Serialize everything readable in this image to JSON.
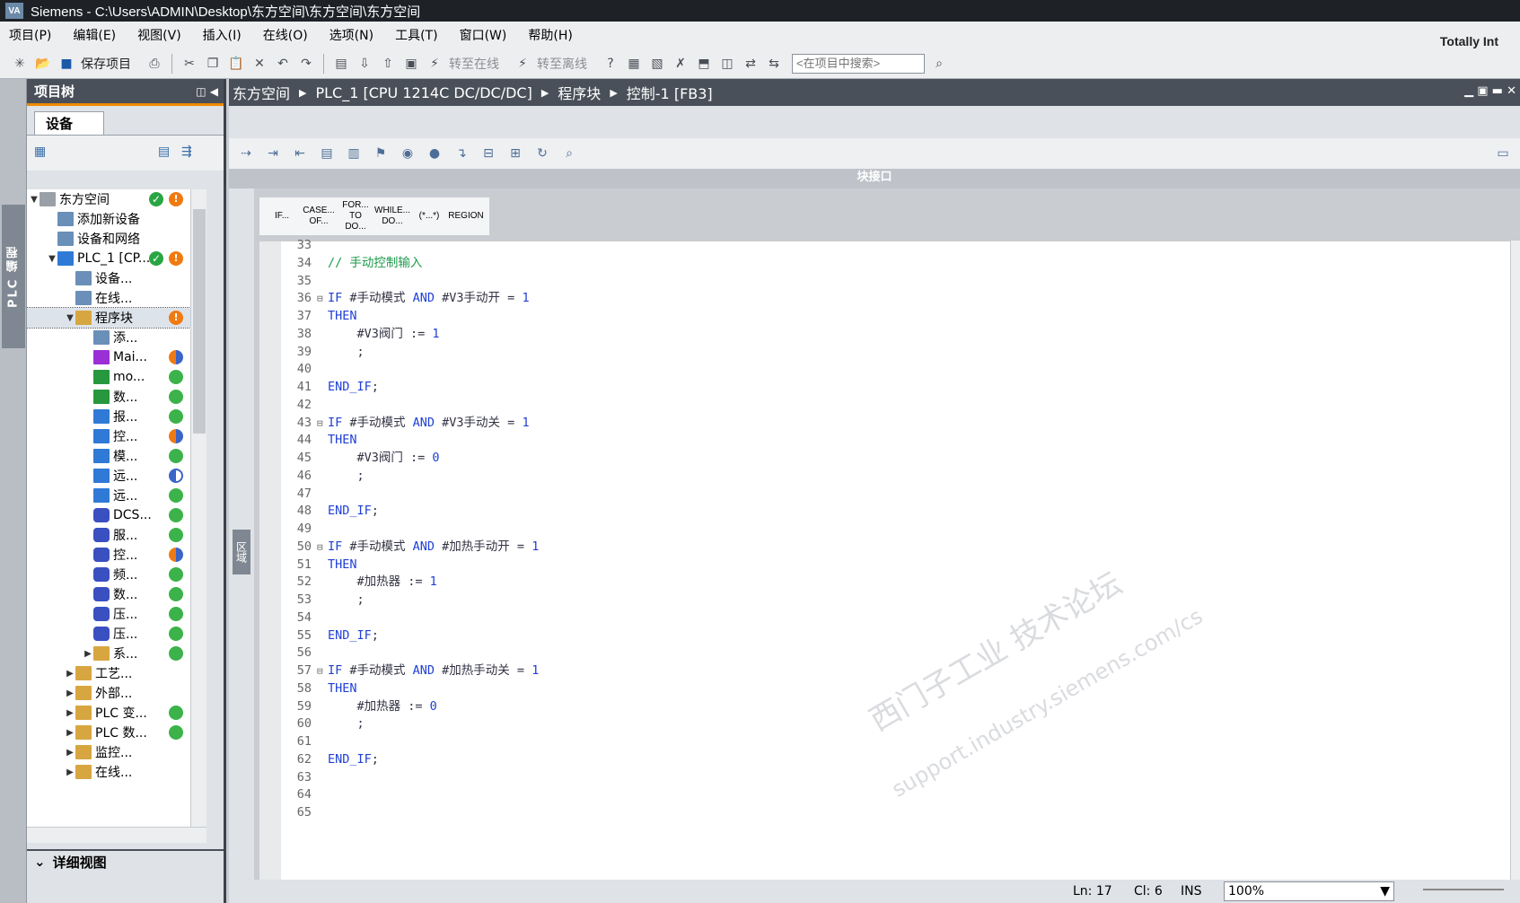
{
  "titlebar": {
    "logo": "VA",
    "text": "Siemens  -  C:\\Users\\ADMIN\\Desktop\\东方空间\\东方空间\\东方空间"
  },
  "menu": [
    "项目(P)",
    "编辑(E)",
    "视图(V)",
    "插入(I)",
    "在线(O)",
    "选项(N)",
    "工具(T)",
    "窗口(W)",
    "帮助(H)"
  ],
  "brand": "Totally Int",
  "toolbar": {
    "save_label": "保存项目",
    "go_online": "转至在线",
    "go_offline": "转至离线",
    "search_placeholder": "<在项目中搜索>"
  },
  "left_tab": "PLC 编程",
  "tree": {
    "title": "项目树",
    "device_tab": "设备",
    "items": [
      {
        "label": "东方空间",
        "indent": 0,
        "arrow": "▼",
        "icon": "project-icon",
        "status": "check",
        "status2": "warn"
      },
      {
        "label": "添加新设备",
        "indent": 1,
        "arrow": "",
        "icon": "add-device-icon"
      },
      {
        "label": "设备和网络",
        "indent": 1,
        "arrow": "",
        "icon": "network-icon"
      },
      {
        "label": "PLC_1 [CP...",
        "indent": 1,
        "arrow": "▼",
        "icon": "plc-icon",
        "status": "check",
        "status2": "warn"
      },
      {
        "label": "设备...",
        "indent": 2,
        "arrow": "",
        "icon": "device-config-icon"
      },
      {
        "label": "在线...",
        "indent": 2,
        "arrow": "",
        "icon": "online-diag-icon"
      },
      {
        "label": "程序块",
        "indent": 2,
        "arrow": "▼",
        "icon": "folder-icon",
        "status2": "warn",
        "selected": true
      },
      {
        "label": "添...",
        "indent": 3,
        "arrow": "",
        "icon": "add-block-icon"
      },
      {
        "label": "Mai...",
        "indent": 3,
        "arrow": "",
        "icon": "ob-icon",
        "status2": "half"
      },
      {
        "label": "mo...",
        "indent": 3,
        "arrow": "",
        "icon": "fc-icon",
        "status2": "green"
      },
      {
        "label": "数...",
        "indent": 3,
        "arrow": "",
        "icon": "fc-icon",
        "status2": "green"
      },
      {
        "label": "报...",
        "indent": 3,
        "arrow": "",
        "icon": "fb-icon",
        "status2": "green"
      },
      {
        "label": "控...",
        "indent": 3,
        "arrow": "",
        "icon": "fb-icon",
        "status2": "half"
      },
      {
        "label": "模...",
        "indent": 3,
        "arrow": "",
        "icon": "fb-icon",
        "status2": "green"
      },
      {
        "label": "远...",
        "indent": 3,
        "arrow": "",
        "icon": "fb-icon",
        "status2": "halfw"
      },
      {
        "label": "远...",
        "indent": 3,
        "arrow": "",
        "icon": "fb-icon",
        "status2": "green"
      },
      {
        "label": "DCS...",
        "indent": 3,
        "arrow": "",
        "icon": "db-icon",
        "status2": "green"
      },
      {
        "label": "服...",
        "indent": 3,
        "arrow": "",
        "icon": "db-icon",
        "status2": "green"
      },
      {
        "label": "控...",
        "indent": 3,
        "arrow": "",
        "icon": "db-icon",
        "status2": "half"
      },
      {
        "label": "频...",
        "indent": 3,
        "arrow": "",
        "icon": "db-icon",
        "status2": "green"
      },
      {
        "label": "数...",
        "indent": 3,
        "arrow": "",
        "icon": "db-icon",
        "status2": "green"
      },
      {
        "label": "压...",
        "indent": 3,
        "arrow": "",
        "icon": "db-icon",
        "status2": "green"
      },
      {
        "label": "压...",
        "indent": 3,
        "arrow": "",
        "icon": "db-icon",
        "status2": "green"
      },
      {
        "label": "系...",
        "indent": 3,
        "arrow": "▶",
        "icon": "folder-icon",
        "status2": "green"
      },
      {
        "label": "工艺...",
        "indent": 2,
        "arrow": "▶",
        "icon": "folder-icon"
      },
      {
        "label": "外部...",
        "indent": 2,
        "arrow": "▶",
        "icon": "folder-icon"
      },
      {
        "label": "PLC 变...",
        "indent": 2,
        "arrow": "▶",
        "icon": "folder-icon",
        "status2": "green"
      },
      {
        "label": "PLC 数...",
        "indent": 2,
        "arrow": "▶",
        "icon": "folder-icon",
        "status2": "green"
      },
      {
        "label": "监控...",
        "indent": 2,
        "arrow": "▶",
        "icon": "folder-icon"
      },
      {
        "label": "在线...",
        "indent": 2,
        "arrow": "▶",
        "icon": "folder-icon"
      }
    ],
    "detail_view": "详细视图"
  },
  "editor": {
    "breadcrumb": [
      "东方空间",
      "PLC_1 [CPU 1214C DC/DC/DC]",
      "程序块",
      "控制-1 [FB3]"
    ],
    "interface_bar": "块接口",
    "side_label": "区域",
    "snippets": [
      "IF...",
      "CASE... OF...",
      "FOR... TO DO...",
      "WHILE... DO...",
      "(*...*)",
      "REGION"
    ],
    "code": [
      {
        "n": "33",
        "t": ""
      },
      {
        "n": "34",
        "t": "// 手动控制输入",
        "cls": "cm"
      },
      {
        "n": "35",
        "t": ""
      },
      {
        "n": "36",
        "fold": true,
        "t": "IF #手动模式 AND #V3手动开 = 1"
      },
      {
        "n": "37",
        "t": "THEN",
        "cls": "kw"
      },
      {
        "n": "38",
        "t": "    #V3阀门 := 1"
      },
      {
        "n": "39",
        "t": "    ;"
      },
      {
        "n": "40",
        "t": ""
      },
      {
        "n": "41",
        "t": "END_IF;"
      },
      {
        "n": "42",
        "t": ""
      },
      {
        "n": "43",
        "fold": true,
        "t": "IF #手动模式 AND #V3手动关 = 1"
      },
      {
        "n": "44",
        "t": "THEN",
        "cls": "kw"
      },
      {
        "n": "45",
        "t": "    #V3阀门 := 0"
      },
      {
        "n": "46",
        "t": "    ;"
      },
      {
        "n": "47",
        "t": ""
      },
      {
        "n": "48",
        "t": "END_IF;"
      },
      {
        "n": "49",
        "t": ""
      },
      {
        "n": "50",
        "fold": true,
        "t": "IF #手动模式 AND #加热手动开 = 1"
      },
      {
        "n": "51",
        "t": "THEN",
        "cls": "kw"
      },
      {
        "n": "52",
        "t": "    #加热器 := 1"
      },
      {
        "n": "53",
        "t": "    ;"
      },
      {
        "n": "54",
        "t": ""
      },
      {
        "n": "55",
        "t": "END_IF;"
      },
      {
        "n": "56",
        "t": ""
      },
      {
        "n": "57",
        "fold": true,
        "t": "IF #手动模式 AND #加热手动关 = 1"
      },
      {
        "n": "58",
        "t": "THEN",
        "cls": "kw"
      },
      {
        "n": "59",
        "t": "    #加热器 := 0"
      },
      {
        "n": "60",
        "t": "    ;"
      },
      {
        "n": "61",
        "t": ""
      },
      {
        "n": "62",
        "t": "END_IF;"
      },
      {
        "n": "63",
        "t": ""
      },
      {
        "n": "64",
        "t": ""
      },
      {
        "n": "65",
        "t": ""
      }
    ],
    "watermark": "西门子工业 技术论坛",
    "watermark_url": "support.industry.siemens.com/cs"
  },
  "status": {
    "ln": "Ln: 17",
    "cl": "Cl: 6",
    "ins": "INS",
    "zoom": "100%"
  },
  "colors": {
    "accent": "#ee8a00",
    "header": "#4a5059",
    "ok": "#3cb24a",
    "warn": "#f07a10"
  }
}
